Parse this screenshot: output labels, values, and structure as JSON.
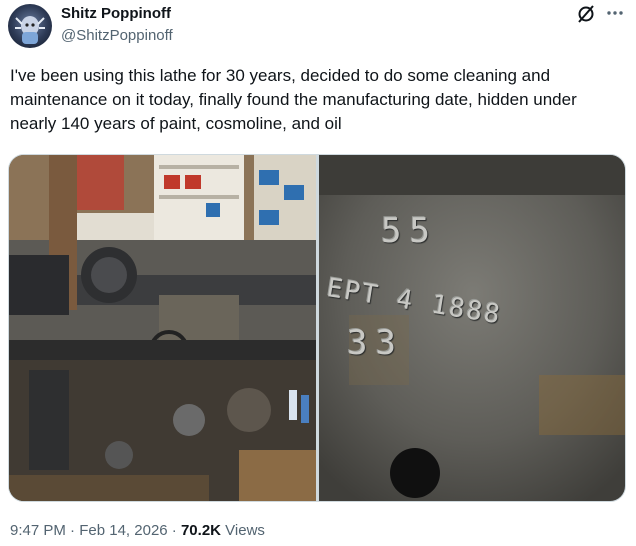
{
  "author": {
    "display_name": "Shitz Poppinoff",
    "handle": "@ShitzPoppinoff"
  },
  "post": {
    "text": "I've been using this lathe for 30 years, decided to do some cleaning and maintenance on it today, finally found the manufacturing date, hidden under nearly 140 years of paint, cosmoline, and oil"
  },
  "media": {
    "stamp_lines": [
      "55",
      "EPT 4 1888",
      "33"
    ]
  },
  "meta": {
    "time": "9:47 PM",
    "sep1": "·",
    "date": "Feb 14, 2026",
    "sep2": "·",
    "views_count": "70.2K",
    "views_label": "Views"
  },
  "icons": {
    "grok": "grok-icon",
    "more": "more-icon"
  }
}
